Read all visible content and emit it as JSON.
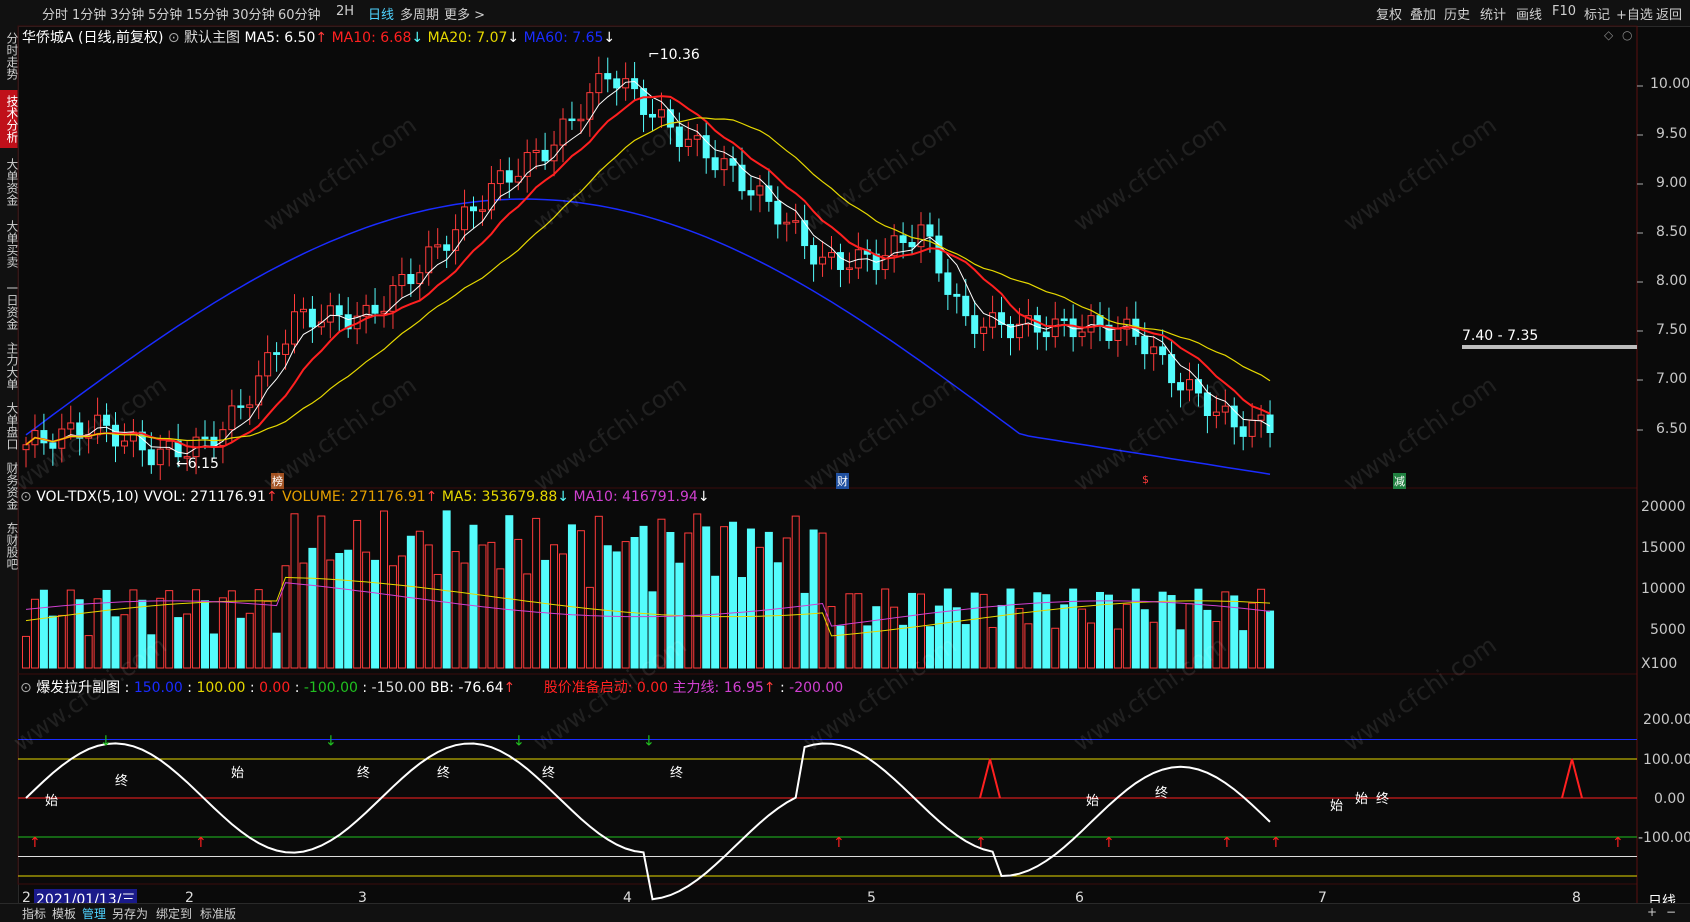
{
  "topbar": {
    "left": [
      "分时",
      "1分钟",
      "3分钟",
      "5分钟",
      "15分钟",
      "30分钟",
      "60分钟",
      "2H",
      "日线",
      "多周期",
      "更多"
    ],
    "right": [
      "复权",
      "叠加",
      "历史",
      "统计",
      "画线",
      "F10",
      "标记",
      "+自选",
      "返回"
    ],
    "active": "日线"
  },
  "sidebar": [
    "分时走势",
    "技术分析",
    "大单资金",
    "大单买卖",
    "一日资金",
    "主力大单",
    "大单盘口",
    "财务资金",
    "东财股吧"
  ],
  "main_legend": {
    "name": "华侨城A (日线,前复权)",
    "template": "默认主图",
    "ma5": "MA5: 6.50",
    "ma10": "MA10: 6.68",
    "ma20": "MA20: 7.07",
    "ma60": "MA60: 7.65"
  },
  "annotations": {
    "high": "10.36",
    "low": "6.15",
    "range": "7.40 - 7.35",
    "events": [
      "榜",
      "财",
      "$",
      "减"
    ]
  },
  "price_axis": [
    "10.00",
    "9.50",
    "9.00",
    "8.50",
    "8.00",
    "7.50",
    "7.00",
    "6.50"
  ],
  "vol_legend": {
    "name": "VOL-TDX(5,10)",
    "vvol": "VVOL: 271176.91",
    "volume": "VOLUME: 271176.91",
    "ma5": "MA5: 353679.88",
    "ma10": "MA10: 416791.94"
  },
  "vol_axis": [
    "20000",
    "15000",
    "10000",
    "5000",
    "X100"
  ],
  "ind_legend": {
    "name": "爆发拉升副图",
    "v1": "150.00",
    "v2": "100.00",
    "v3": "0.00",
    "v4": "-100.00",
    "v5": "-150.00",
    "bb": "BB: -76.64",
    "start": "股价准备启动: 0.00",
    "main": "主力线: 16.95",
    "v6": "-200.00"
  },
  "ind_axis": [
    "200.00",
    "100.00",
    "0.00",
    "-100.00"
  ],
  "ind_texts": [
    "始",
    "终",
    "始",
    "终",
    "终",
    "终",
    "终",
    "始",
    "终",
    "始",
    "始",
    "终"
  ],
  "date_axis": {
    "cursor": "2021/01/13/三",
    "first": "2",
    "months": [
      "2",
      "3",
      "4",
      "5",
      "6",
      "7",
      "8"
    ]
  },
  "period_label": "日线",
  "bottom_bar": [
    "指标",
    "模板",
    "管理",
    "另存为",
    "绑定到",
    "标准版"
  ],
  "watermark": "www.cfchi.com",
  "colors": {
    "up": "#ff3b3b",
    "down": "#54fcfc",
    "ma5": "#ffffff",
    "ma10": "#ff2020",
    "ma20": "#e6d800",
    "ma60": "#1a2cff"
  }
}
